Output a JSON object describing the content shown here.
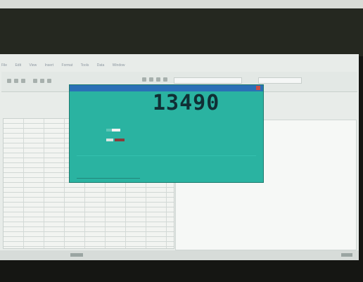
{
  "window": {
    "title": ""
  },
  "menu": {
    "items": [
      "File",
      "Edit",
      "View",
      "Insert",
      "Format",
      "Tools",
      "Data",
      "Window"
    ]
  },
  "toolbar": {
    "right_label": ""
  },
  "dialog": {
    "title": "",
    "counter": "13490",
    "description": "",
    "fields": [],
    "footer": ""
  },
  "colors": {
    "dialog_bg": "#2ab3a1",
    "counter_text": "#102f35",
    "titlebar": "#2b6fb6",
    "taskbar": "#d7dcd9"
  }
}
